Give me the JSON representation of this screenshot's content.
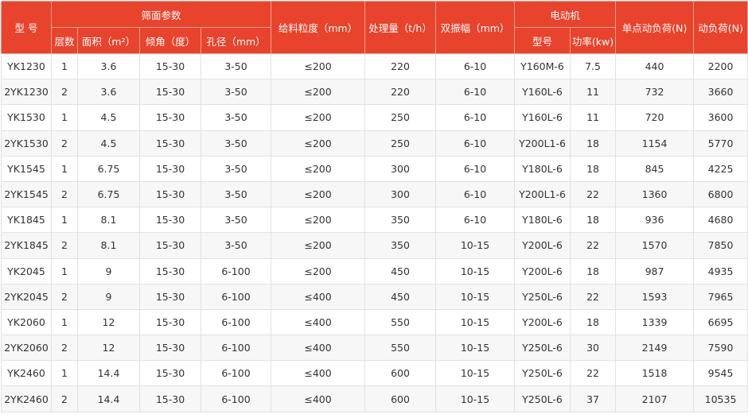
{
  "headers": {
    "model": "型 号",
    "screen_params": "筛面参数",
    "layers": "层数",
    "area": "面积（m²）",
    "angle": "倾角（度）",
    "aperture": "孔径（mm）",
    "feed_size": "给料粒度（mm）",
    "capacity": "处理量（t/h）",
    "amplitude": "双振幅（mm）",
    "motor": "电动机",
    "motor_model": "型号",
    "motor_power": "功率(kw)",
    "point_load": "单点动负荷(N)",
    "dynamic_load": "动负荷(N)"
  },
  "rows": [
    [
      "YK1230",
      "1",
      "3.6",
      "15-30",
      "3-50",
      "≤200",
      "220",
      "6-10",
      "Y160M-6",
      "7.5",
      "440",
      "2200"
    ],
    [
      "2YK1230",
      "2",
      "3.6",
      "15-30",
      "3-50",
      "≤200",
      "220",
      "6-10",
      "Y160L-6",
      "11",
      "732",
      "3660"
    ],
    [
      "YK1530",
      "1",
      "4.5",
      "15-30",
      "3-50",
      "≤200",
      "250",
      "6-10",
      "Y160L-6",
      "11",
      "720",
      "3600"
    ],
    [
      "2YK1530",
      "2",
      "4.5",
      "15-30",
      "3-50",
      "≤200",
      "250",
      "6-10",
      "Y200L1-6",
      "18",
      "1154",
      "5770"
    ],
    [
      "YK1545",
      "1",
      "6.75",
      "15-30",
      "3-50",
      "≤200",
      "300",
      "6-10",
      "Y180L-6",
      "18",
      "845",
      "4225"
    ],
    [
      "2YK1545",
      "2",
      "6.75",
      "15-30",
      "3-50",
      "≤200",
      "300",
      "6-10",
      "Y200L1-6",
      "22",
      "1360",
      "6800"
    ],
    [
      "YK1845",
      "1",
      "8.1",
      "15-30",
      "3-50",
      "≤200",
      "350",
      "6-10",
      "Y180L-6",
      "18",
      "936",
      "4680"
    ],
    [
      "2YK1845",
      "2",
      "8.1",
      "15-30",
      "3-50",
      "≤200",
      "350",
      "10-15",
      "Y200L-6",
      "22",
      "1570",
      "7850"
    ],
    [
      "YK2045",
      "1",
      "9",
      "15-30",
      "6-100",
      "≤200",
      "450",
      "10-15",
      "Y200L-6",
      "18",
      "987",
      "4935"
    ],
    [
      "2YK2045",
      "2",
      "9",
      "15-30",
      "6-100",
      "≤400",
      "450",
      "10-15",
      "Y250L-6",
      "22",
      "1593",
      "7965"
    ],
    [
      "YK2060",
      "1",
      "12",
      "15-30",
      "6-100",
      "≤400",
      "550",
      "10-15",
      "Y200L-6",
      "18",
      "1339",
      "6695"
    ],
    [
      "2YK2060",
      "2",
      "12",
      "15-30",
      "6-100",
      "≤400",
      "550",
      "10-15",
      "Y250L-6",
      "30",
      "2149",
      "7590"
    ],
    [
      "YK2460",
      "1",
      "14.4",
      "15-30",
      "6-100",
      "≤400",
      "600",
      "10-15",
      "Y250L-6",
      "22",
      "1518",
      "9545"
    ],
    [
      "2YK2460",
      "2",
      "14.4",
      "15-30",
      "6-100",
      "≤400",
      "600",
      "10-15",
      "Y250L-6",
      "37",
      "2107",
      "10535"
    ]
  ]
}
